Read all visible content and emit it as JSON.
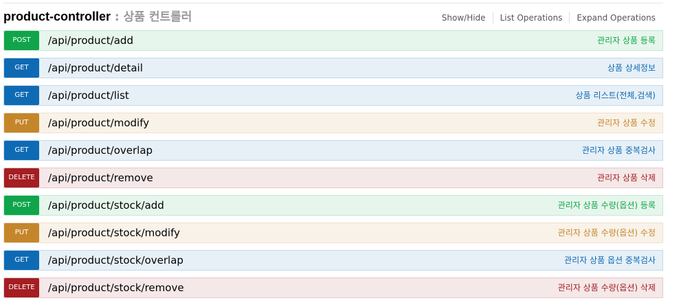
{
  "controller": {
    "name": "product-controller",
    "description": " : 상품 컨트롤러"
  },
  "operations_links": {
    "show_hide": "Show/Hide",
    "list_operations": "List Operations",
    "expand_operations": "Expand Operations"
  },
  "endpoints": [
    {
      "method": "POST",
      "path": "/api/product/add",
      "summary": "관리자 상품 등록"
    },
    {
      "method": "GET",
      "path": "/api/product/detail",
      "summary": "상품 상세정보"
    },
    {
      "method": "GET",
      "path": "/api/product/list",
      "summary": "상품 리스트(전체,검색)"
    },
    {
      "method": "PUT",
      "path": "/api/product/modify",
      "summary": "관리자 상품 수정"
    },
    {
      "method": "GET",
      "path": "/api/product/overlap",
      "summary": "관리자 상품 중복검사"
    },
    {
      "method": "DELETE",
      "path": "/api/product/remove",
      "summary": "관리자 상품 삭제"
    },
    {
      "method": "POST",
      "path": "/api/product/stock/add",
      "summary": "관리자 상품 수량(옵션) 등록"
    },
    {
      "method": "PUT",
      "path": "/api/product/stock/modify",
      "summary": "관리자 상품 수량(옵션) 수정"
    },
    {
      "method": "GET",
      "path": "/api/product/stock/overlap",
      "summary": "관리자 상품 옵션 중복검사"
    },
    {
      "method": "DELETE",
      "path": "/api/product/stock/remove",
      "summary": "관리자 상품 수량(옵션) 삭제"
    }
  ],
  "colors": {
    "post": "#10a54a",
    "get": "#0f6ab4",
    "put": "#c5862b",
    "delete": "#a41e22"
  }
}
